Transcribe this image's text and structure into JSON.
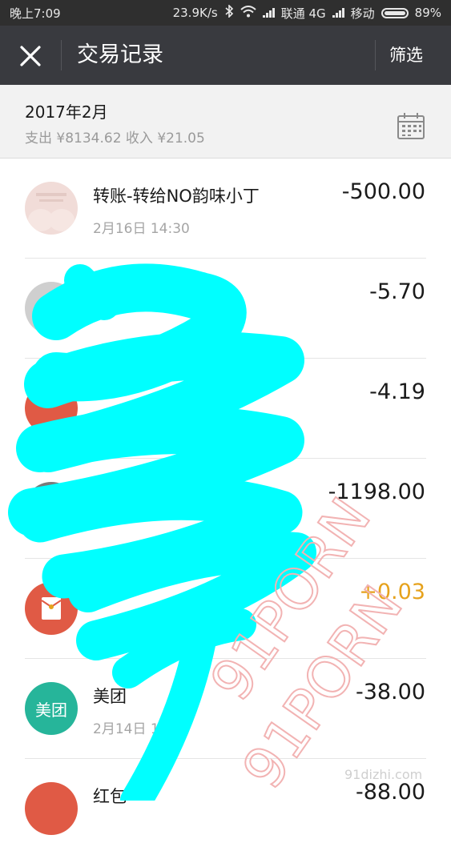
{
  "status_bar": {
    "time": "晚上7:09",
    "speed": "23.9K/s",
    "carrier1": "联通 4G",
    "carrier2": "移动",
    "battery": "89%"
  },
  "nav": {
    "title": "交易记录",
    "filter_label": "筛选",
    "close_icon": "close-icon"
  },
  "month": {
    "title": "2017年2月",
    "summary": "支出 ¥8134.62 收入 ¥21.05",
    "calendar_icon": "calendar-icon"
  },
  "transactions": [
    {
      "title": "转账-转给NO韵味小丁",
      "time": "2月16日 14:30",
      "amount": "-500.00",
      "avatar_color": "#f1dcd8",
      "type": "expense"
    },
    {
      "title": "",
      "time": "",
      "amount": "-5.70",
      "avatar_color": "#cfcfcf",
      "type": "expense"
    },
    {
      "title": "",
      "time": "",
      "amount": "-4.19",
      "avatar_color": "#e05a45",
      "type": "expense"
    },
    {
      "title": "",
      "time": "",
      "amount": "-1198.00",
      "avatar_color": "#7a7a7a",
      "type": "expense"
    },
    {
      "title": "",
      "time": "",
      "amount": "+0.03",
      "avatar_color": "#e05a45",
      "type": "income"
    },
    {
      "title": "美团",
      "time": "2月14日 1",
      "amount": "-38.00",
      "avatar_color": "#26b59a",
      "avatar_text": "美团",
      "type": "expense"
    },
    {
      "title": "红包",
      "time": "",
      "amount": "-88.00",
      "avatar_color": "#e05a45",
      "type": "expense"
    }
  ],
  "watermark": {
    "text1": "91PORN",
    "text2": "91PORN",
    "site": "91dizhi.com"
  },
  "colors": {
    "navbar": "#393a3f",
    "income": "#e6a21c",
    "scribble": "#00ffff"
  }
}
